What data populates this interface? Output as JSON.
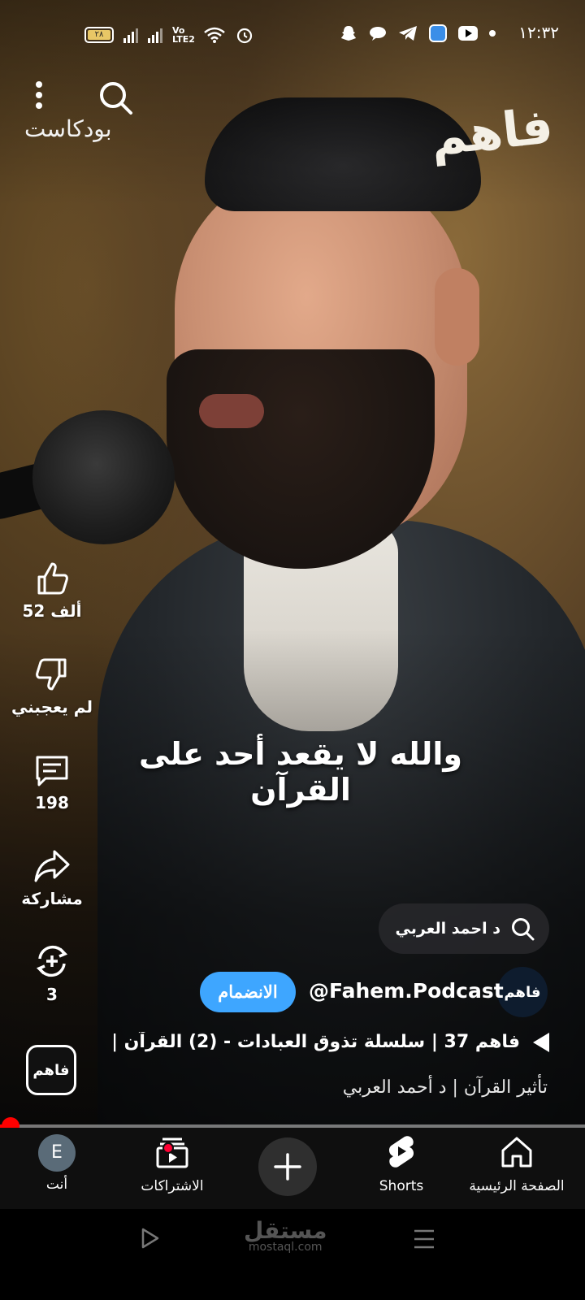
{
  "status_bar": {
    "time": "١٢:٣٢",
    "battery_level": "٢٨",
    "volte": "Vo LTE2"
  },
  "top": {
    "search_icon": "search-icon",
    "more_icon": "more-vert-icon",
    "section_label": "بودكاست",
    "brand_logo_text": "فاهم"
  },
  "video": {
    "caption": "والله لا يقعد أحد على القرآن"
  },
  "actions": {
    "like_count": "52 ألف",
    "dislike_label": "لم يعجبني",
    "comment_count": "198",
    "share_label": "مشاركة",
    "remix_count": "3"
  },
  "search_chip": {
    "query": "د احمد العربي"
  },
  "channel": {
    "avatar_text": "فاهم",
    "handle": "@Fahem.Podcast",
    "subscribe_label": "الانضمام"
  },
  "video_info": {
    "title": "فاهم 37 | سلسلة تذوق العبادات - (2) القرآن |...",
    "subtitle": "تأثير القرآن | د أحمد العربي"
  },
  "album": {
    "text": "فاهم"
  },
  "progress": {
    "fraction": 0.01
  },
  "bottom_nav": {
    "home": "الصفحة الرئيسية",
    "shorts": "Shorts",
    "subscriptions": "الاشتراكات",
    "you": "أنت",
    "avatar_letter": "E"
  },
  "watermark": {
    "line1": "مستقل",
    "line2": "mostaql.com"
  },
  "colors": {
    "subscribe": "#3ea6ff",
    "progress": "#ff0000",
    "nav_bg": "#0f0f0f"
  }
}
